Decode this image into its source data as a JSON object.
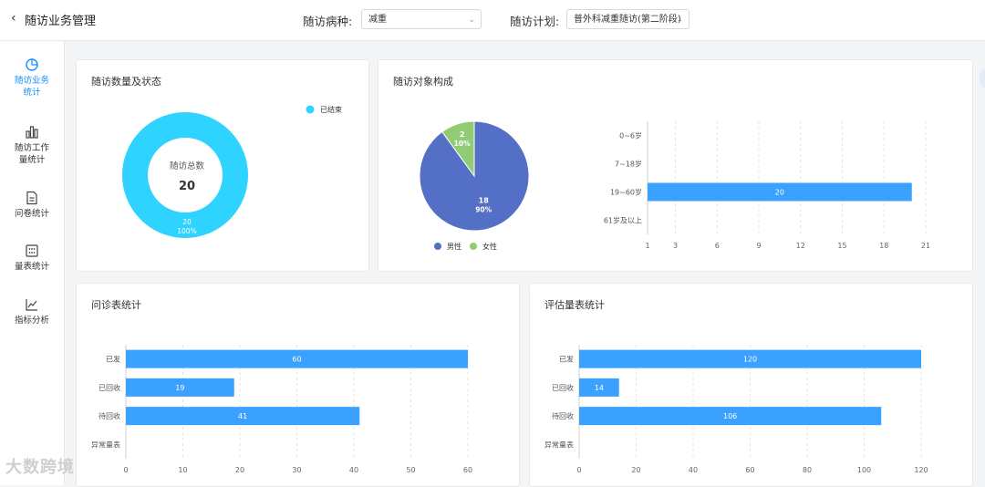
{
  "header": {
    "back_icon": "chevron-left-icon",
    "title": "随访业务管理",
    "disease_label": "随访病种:",
    "disease_value": "减重",
    "plan_label": "随访计划:",
    "plan_value": "普外科减重随访(第二阶段)"
  },
  "sidebar": {
    "items": [
      {
        "label_line1": "随访业务",
        "label_line2": "统计",
        "icon": "pie-chart-icon",
        "active": true
      },
      {
        "label_line1": "随访工作",
        "label_line2": "量统计",
        "icon": "bar-chart-icon",
        "active": false
      },
      {
        "label_line1": "问卷统计",
        "label_line2": "",
        "icon": "document-icon",
        "active": false
      },
      {
        "label_line1": "量表统计",
        "label_line2": "",
        "icon": "calculator-icon",
        "active": false
      },
      {
        "label_line1": "指标分析",
        "label_line2": "",
        "icon": "line-chart-icon",
        "active": false
      }
    ]
  },
  "cards": {
    "followup_status_title": "随访数量及状态",
    "followup_subjects_title": "随访对象构成",
    "inquiry_title": "问诊表统计",
    "assessment_title": "评估量表统计"
  },
  "chart_data": [
    {
      "type": "pie",
      "variant": "donut",
      "center_label": "随访总数",
      "center_value": 20,
      "slices": [
        {
          "name": "已结束",
          "value": 20,
          "percent": "100%",
          "color": "#2fd3ff"
        }
      ],
      "legend": "top-right"
    },
    {
      "type": "pie",
      "slices": [
        {
          "name": "男性",
          "value": 18,
          "percent": "90%",
          "color": "#5470c6"
        },
        {
          "name": "女性",
          "value": 2,
          "percent": "10%",
          "color": "#91cc75"
        }
      ],
      "legend": "bottom"
    },
    {
      "type": "bar",
      "orientation": "horizontal",
      "categories": [
        "0~6岁",
        "7~18岁",
        "19~60岁",
        "61岁及以上"
      ],
      "values": [
        0,
        0,
        20,
        0
      ],
      "x_ticks": [
        1,
        3,
        6,
        9,
        12,
        15,
        18,
        21
      ],
      "xlim": [
        1,
        21
      ],
      "color": "#3aa1ff",
      "grid": "vertical-dashed"
    },
    {
      "type": "bar",
      "orientation": "horizontal",
      "categories": [
        "已发",
        "已回收",
        "待回收",
        "异常量表"
      ],
      "values": [
        60,
        19,
        41,
        0
      ],
      "x_ticks": [
        0,
        10,
        20,
        30,
        40,
        50,
        60
      ],
      "xlim": [
        0,
        60
      ],
      "color": "#3aa1ff",
      "grid": "vertical-dashed"
    },
    {
      "type": "bar",
      "orientation": "horizontal",
      "categories": [
        "已发",
        "已回收",
        "待回收",
        "异常量表"
      ],
      "values": [
        120,
        14,
        106,
        0
      ],
      "x_ticks": [
        0,
        20,
        40,
        60,
        80,
        100,
        120
      ],
      "xlim": [
        0,
        120
      ],
      "color": "#3aa1ff",
      "grid": "vertical-dashed"
    }
  ],
  "watermark": "大数跨境"
}
